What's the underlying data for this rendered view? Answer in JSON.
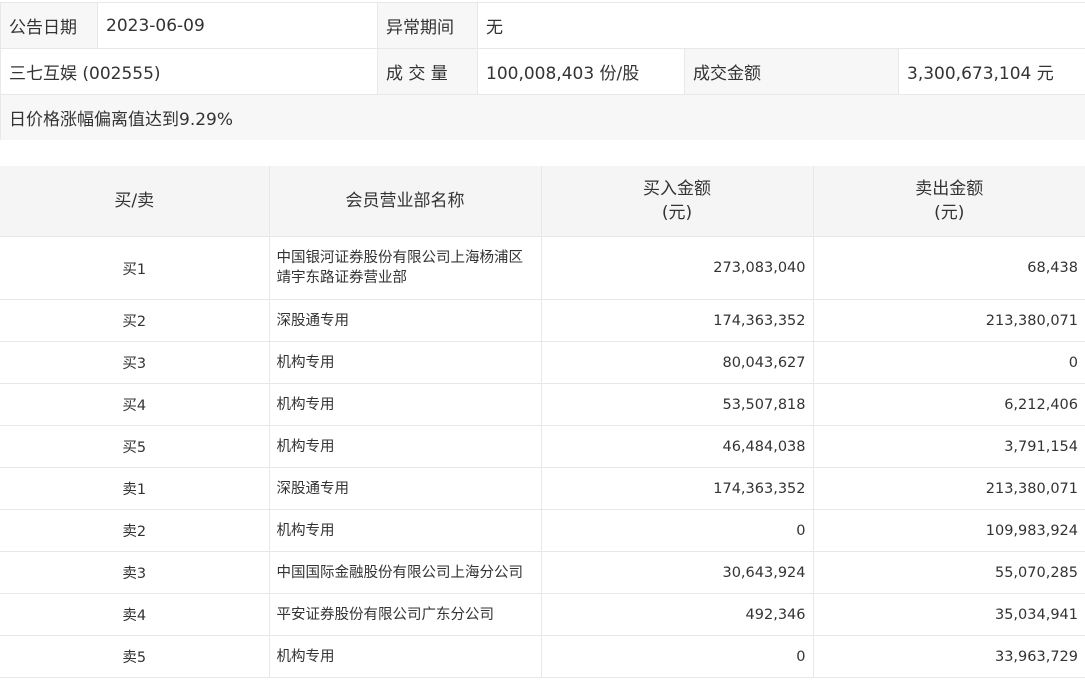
{
  "info": {
    "date_label": "公告日期",
    "date_value": "2023-06-09",
    "period_label": "异常期间",
    "period_value": "无",
    "stock": "三七互娱 (002555)",
    "volume_label": "成 交 量",
    "volume_value": "100,008,403 份/股",
    "amount_label": "成交金额",
    "amount_value": "3,300,673,104 元",
    "reason": "日价格涨幅偏离值达到9.29%"
  },
  "table": {
    "headers": {
      "side": "买/卖",
      "member": "会员营业部名称",
      "buy_line1": "买入金额",
      "buy_line2": "(元)",
      "sell_line1": "卖出金额",
      "sell_line2": "(元)"
    },
    "rows": [
      {
        "side": "买1",
        "member": "中国银河证券股份有限公司上海杨浦区靖宇东路证券营业部",
        "buy": "273,083,040",
        "sell": "68,438"
      },
      {
        "side": "买2",
        "member": "深股通专用",
        "buy": "174,363,352",
        "sell": "213,380,071"
      },
      {
        "side": "买3",
        "member": "机构专用",
        "buy": "80,043,627",
        "sell": "0"
      },
      {
        "side": "买4",
        "member": "机构专用",
        "buy": "53,507,818",
        "sell": "6,212,406"
      },
      {
        "side": "买5",
        "member": "机构专用",
        "buy": "46,484,038",
        "sell": "3,791,154"
      },
      {
        "side": "卖1",
        "member": "深股通专用",
        "buy": "174,363,352",
        "sell": "213,380,071"
      },
      {
        "side": "卖2",
        "member": "机构专用",
        "buy": "0",
        "sell": "109,983,924"
      },
      {
        "side": "卖3",
        "member": "中国国际金融股份有限公司上海分公司",
        "buy": "30,643,924",
        "sell": "55,070,285"
      },
      {
        "side": "卖4",
        "member": "平安证券股份有限公司广东分公司",
        "buy": "492,346",
        "sell": "35,034,941"
      },
      {
        "side": "卖5",
        "member": "机构专用",
        "buy": "0",
        "sell": "33,963,729"
      }
    ]
  }
}
